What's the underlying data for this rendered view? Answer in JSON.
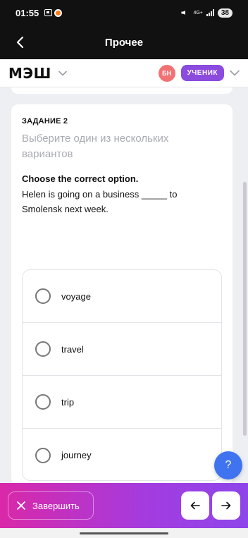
{
  "status_bar": {
    "time": "01:55",
    "network": "4G+",
    "battery": "38"
  },
  "header": {
    "title": "Прочее"
  },
  "brand": {
    "logo": "МЭШ",
    "avatar_initials": "БН",
    "role": "УЧЕНИК"
  },
  "task": {
    "number": "ЗАДАНИЕ 2",
    "hint": "Выберите один из нескольких вариантов",
    "question": "Choose the correct option.",
    "sentence": "Helen is going on a business _____ to Smolensk next week.",
    "options": [
      {
        "label": "voyage"
      },
      {
        "label": "travel"
      },
      {
        "label": "trip"
      },
      {
        "label": "journey"
      }
    ]
  },
  "help": {
    "label": "?"
  },
  "footer": {
    "finish_label": "Завершить"
  },
  "colors": {
    "accent_purple": "#8a4bde",
    "avatar_red": "#f17275",
    "help_blue": "#3f73f0",
    "gradient_start": "#d928a8",
    "gradient_end": "#8d45ea"
  }
}
